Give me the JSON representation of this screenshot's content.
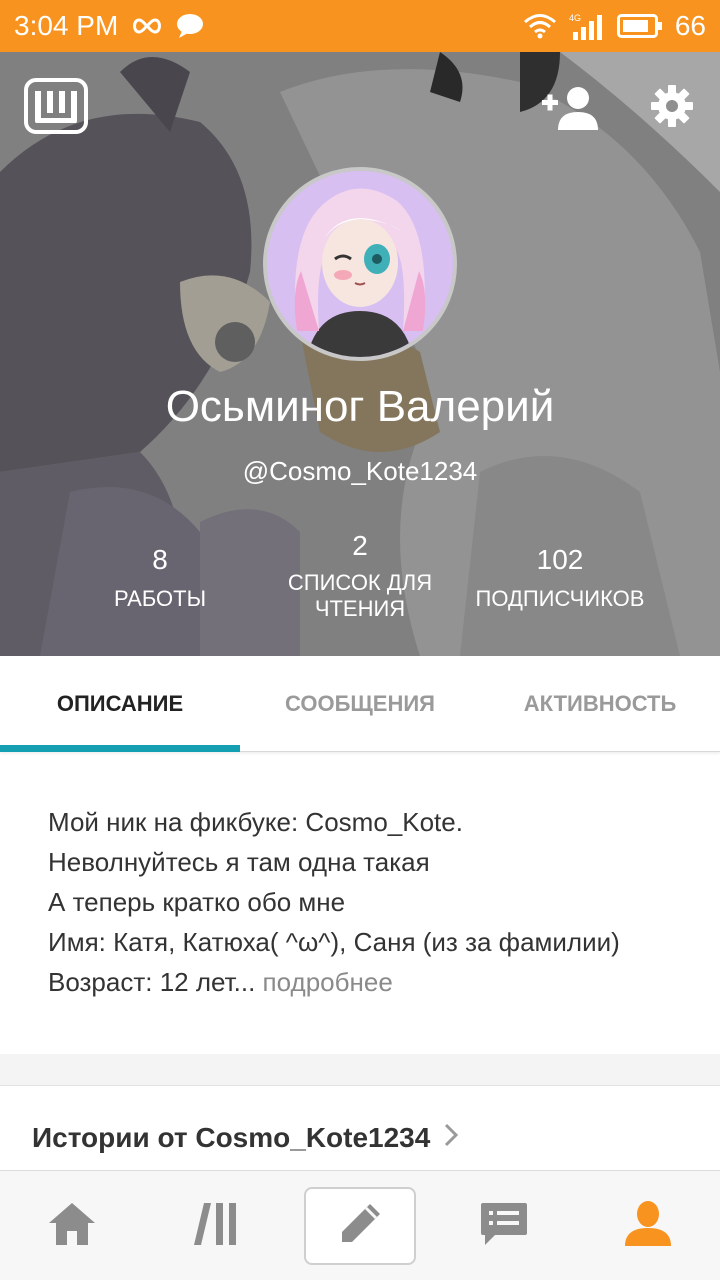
{
  "status_bar": {
    "time": "3:04 PM",
    "battery": "66",
    "network": "4G",
    "icons": [
      "infinity-icon",
      "chat-bubble-icon",
      "wifi-icon",
      "signal-icon",
      "battery-icon"
    ]
  },
  "header": {
    "logo_icon": "wattpad-logo-icon",
    "add_user_icon": "add-user-icon",
    "settings_icon": "gear-icon",
    "display_name": "Осьминог Валерий",
    "username": "@Cosmo_Kote1234",
    "stats": {
      "works": {
        "value": "8",
        "label": "РАБОТЫ"
      },
      "reading_lists": {
        "value": "2",
        "label_line1": "СПИСОК ДЛЯ",
        "label_line2": "ЧТЕНИЯ"
      },
      "followers": {
        "value": "102",
        "label": "ПОДПИСЧИКОВ"
      }
    }
  },
  "tabs": [
    {
      "label": "ОПИСАНИЕ",
      "active": true
    },
    {
      "label": "СООБЩЕНИЯ",
      "active": false
    },
    {
      "label": "АКТИВНОСТЬ",
      "active": false
    }
  ],
  "description": {
    "lines": [
      "Мой ник на фикбуке: Cosmo_Kote.",
      "Неволнуйтесь я там одна такая",
      "А теперь кратко обо мне",
      "Имя: Катя, Катюха( ^ω^), Саня (из за фамилии)",
      "Возраст: 12 лет"
    ],
    "ellipsis": "...",
    "more_link": " подробнее"
  },
  "stories": {
    "title": "Истории от Cosmo_Kote1234"
  },
  "bottom_nav": [
    {
      "name": "home-icon"
    },
    {
      "name": "library-icon"
    },
    {
      "name": "pencil-icon"
    },
    {
      "name": "messages-icon"
    },
    {
      "name": "profile-icon",
      "active": true
    }
  ],
  "colors": {
    "status_bar": "#f7931e",
    "active_tab_indicator": "#14a0b2",
    "active_nav": "#f7931e",
    "nav_icon": "#8c8c8c"
  }
}
